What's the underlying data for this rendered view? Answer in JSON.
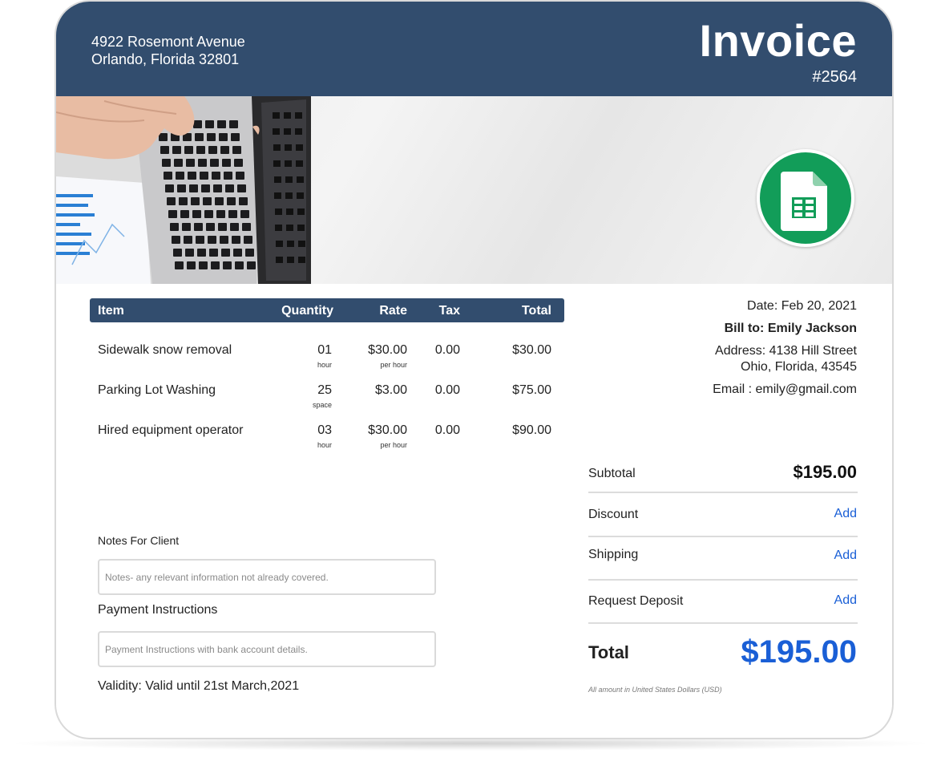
{
  "sender": {
    "address_line1": "4922 Rosemont Avenue",
    "address_line2": "Orlando, Florida 32801"
  },
  "invoice": {
    "title": "Invoice",
    "number": "#2564"
  },
  "table": {
    "headers": {
      "item": "Item",
      "quantity": "Quantity",
      "rate": "Rate",
      "tax": "Tax",
      "total": "Total"
    },
    "rows": [
      {
        "item": "Sidewalk snow removal",
        "quantity": "01",
        "quantity_unit": "hour",
        "rate": "$30.00",
        "rate_unit": "per hour",
        "tax": "0.00",
        "total": "$30.00"
      },
      {
        "item": "Parking Lot Washing",
        "quantity": "25",
        "quantity_unit": "space",
        "rate": "$3.00",
        "rate_unit": "",
        "tax": "0.00",
        "total": "$75.00"
      },
      {
        "item": "Hired equipment operator",
        "quantity": "03",
        "quantity_unit": "hour",
        "rate": "$30.00",
        "rate_unit": "per hour",
        "tax": "0.00",
        "total": "$90.00"
      }
    ]
  },
  "billing": {
    "date": "Date: Feb 20, 2021",
    "bill_to": "Bill to: Emily Jackson",
    "address_line1": "Address: 4138 Hill Street",
    "address_line2": "Ohio, Florida, 43545",
    "email": "Email : emily@gmail.com"
  },
  "notes": {
    "label": "Notes For Client",
    "placeholder": "Notes- any relevant information not already covered."
  },
  "payment": {
    "label": "Payment Instructions",
    "placeholder": "Payment Instructions with bank account details."
  },
  "validity": "Validity: Valid until 21st March,2021",
  "summary": {
    "subtotal_label": "Subtotal",
    "subtotal_value": "$195.00",
    "discount_label": "Discount",
    "shipping_label": "Shipping",
    "deposit_label": "Request Deposit",
    "add_label": "Add",
    "total_label": "Total",
    "total_value": "$195.00",
    "footnote": "All amount in United States Dollars (USD)"
  },
  "icons": {
    "app_logo": "google-sheets-icon",
    "banner": "laptop-photo"
  },
  "colors": {
    "header_bg": "#324d6e",
    "accent_blue": "#1a5fd6",
    "sheets_green": "#129d59"
  }
}
